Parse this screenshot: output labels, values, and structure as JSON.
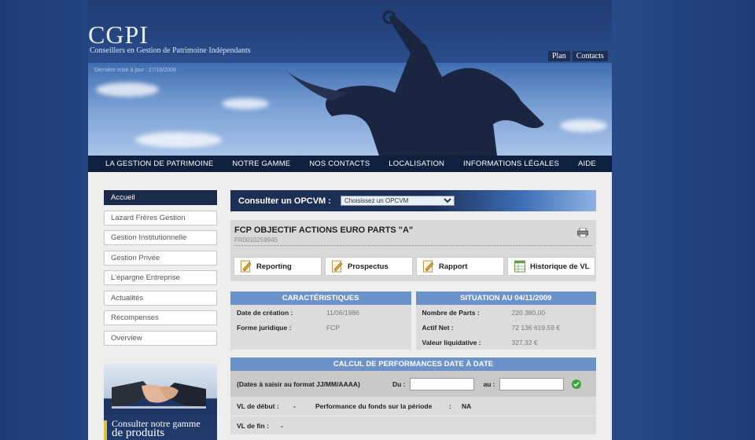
{
  "brand": {
    "logo": "CGPI",
    "tagline": "Conseillers en Gestion de Patrimoine Indépendants",
    "updated": "Dernière mise à jour : 27/10/2009"
  },
  "toplinks": [
    "Plan",
    "Contacts"
  ],
  "nav": [
    "LA GESTION DE PATRIMOINE",
    "NOTRE GAMME",
    "NOS CONTACTS",
    "LOCALISATION",
    "INFORMATIONS LÉGALES",
    "AIDE"
  ],
  "sidebar": {
    "items": [
      "Accueil",
      "Lazard Frères Gestion",
      "Gestion Institutionnelle",
      "Gestion Privée",
      "L'épargne Entreprise",
      "Actualités",
      "Récompenses",
      "Overview"
    ],
    "promo_line1": "Consulter notre gamme",
    "promo_line2": "de produits"
  },
  "consult": {
    "label": "Consulter un OPCVM :",
    "select_value": "Choisissez un OPCVM"
  },
  "fund": {
    "title": "FCP OBJECTIF ACTIONS EURO PARTS \"A\"",
    "isin": "FR0010259945",
    "buttons": [
      "Reporting",
      "Prospectus",
      "Rapport",
      "Historique de VL"
    ]
  },
  "characteristics": {
    "heading": "CARACTÉRISTIQUES",
    "rows": [
      {
        "k": "Date de création :",
        "v": "11/06/1986"
      },
      {
        "k": "Forme juridique :",
        "v": "FCP"
      }
    ]
  },
  "situation": {
    "heading": "SITUATION AU 04/11/2009",
    "rows": [
      {
        "k": "Nombre de Parts :",
        "v": "220 380,00"
      },
      {
        "k": "Actif Net :",
        "v": "72 136 619,59 €"
      },
      {
        "k": "Valeur liquidative :",
        "v": "327,32 €"
      }
    ]
  },
  "perf": {
    "heading": "CALCUL DE PERFORMANCES DATE À DATE",
    "hint": "(Dates à saisir au format JJ/MM/AAAA)",
    "du": "Du :",
    "au": "au :",
    "vl_debut": "VL de début :",
    "vl_debut_val": "-",
    "perf_label": "Performance du fonds sur la période",
    "perf_sep": ":",
    "perf_val": "NA",
    "vl_fin": "VL de fin :",
    "vl_fin_val": "-"
  },
  "colors": {
    "nav_bg": "#0f1f3e",
    "section_head": "#6b92c9",
    "active_side": "#1a2a4a"
  }
}
